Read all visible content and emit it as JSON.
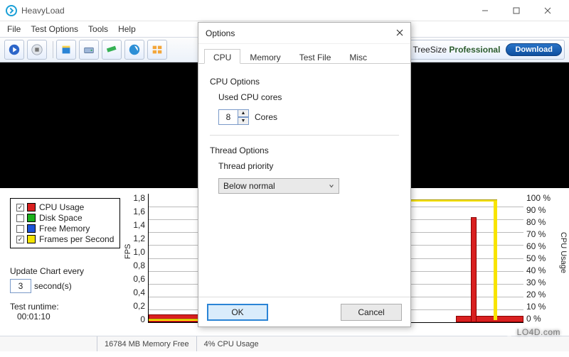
{
  "window": {
    "title": "HeavyLoad"
  },
  "menu": {
    "file": "File",
    "test_options": "Test Options",
    "tools": "Tools",
    "help": "Help"
  },
  "promo": {
    "label_a": "TreeSize",
    "label_b": "Professional",
    "download": "Download"
  },
  "dialog": {
    "title": "Options",
    "tabs": {
      "cpu": "CPU",
      "memory": "Memory",
      "test_file": "Test File",
      "misc": "Misc"
    },
    "cpu_options": "CPU Options",
    "used_cores_label": "Used CPU cores",
    "cores_value": "8",
    "cores_suffix": "Cores",
    "thread_options": "Thread Options",
    "thread_priority_label": "Thread priority",
    "thread_priority_value": "Below normal",
    "ok": "OK",
    "cancel": "Cancel"
  },
  "legend": {
    "cpu": {
      "checked": true,
      "label": "CPU Usage",
      "color": "#d92020"
    },
    "disk": {
      "checked": false,
      "label": "Disk Space",
      "color": "#1cb01c"
    },
    "mem": {
      "checked": false,
      "label": "Free Memory",
      "color": "#1c54d9"
    },
    "fps": {
      "checked": true,
      "label": "Frames per Second",
      "color": "#f3e400"
    }
  },
  "update": {
    "label": "Update Chart every",
    "value": "3",
    "unit": "second(s)"
  },
  "runtime": {
    "label": "Test runtime:",
    "value": "00:01:10"
  },
  "axes": {
    "fps": {
      "label": "FPS",
      "ticks": [
        "1,8",
        "1,6",
        "1,4",
        "1,2",
        "1,0",
        "0,8",
        "0,6",
        "0,4",
        "0,2",
        "0"
      ]
    },
    "cpu": {
      "label": "CPU Usage",
      "ticks": [
        "100 %",
        "90 %",
        "80 %",
        "70 %",
        "60 %",
        "50 %",
        "40 %",
        "30 %",
        "20 %",
        "10 %",
        "0 %"
      ]
    }
  },
  "chart_data": {
    "type": "line",
    "series": [
      {
        "name": "CPU Usage",
        "color": "#d92020",
        "unit": "%",
        "values": [
          5,
          6,
          5,
          7,
          6,
          5,
          6,
          5,
          82,
          6,
          5
        ]
      },
      {
        "name": "Frames per Second",
        "color": "#f3e400",
        "unit": "fps",
        "values": [
          0,
          0,
          0,
          0,
          0,
          0,
          0,
          0,
          0,
          0,
          0,
          0,
          0,
          0,
          0,
          1.8,
          1.8,
          1.8,
          1.78,
          1.8,
          1.78,
          0,
          0
        ]
      }
    ],
    "y_left": {
      "label": "FPS",
      "range": [
        0,
        1.8
      ]
    },
    "y_right": {
      "label": "CPU Usage",
      "range": [
        0,
        100
      ]
    }
  },
  "status": {
    "mem": "16784 MB Memory Free",
    "cpu": "4% CPU Usage"
  },
  "watermark": "LO4D.com"
}
